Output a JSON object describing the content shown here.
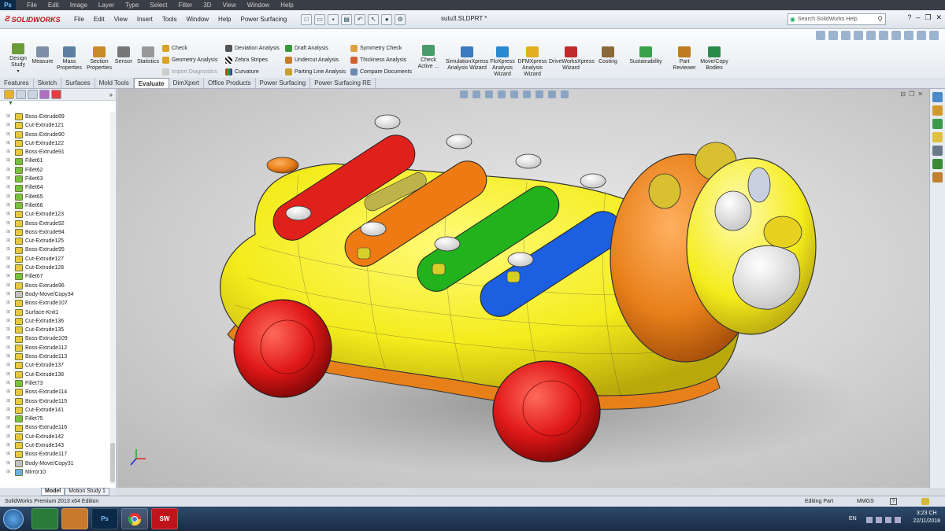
{
  "ps_menu": [
    "File",
    "Edit",
    "Image",
    "Layer",
    "Type",
    "Select",
    "Filter",
    "3D",
    "View",
    "Window",
    "Help"
  ],
  "app": {
    "logo_text": "SOLIDWORKS",
    "doc_title": "sutu3.SLDPRT *",
    "search_placeholder": "Search SolidWorks Help"
  },
  "menu": [
    "File",
    "Edit",
    "View",
    "Insert",
    "Tools",
    "Window",
    "Help",
    "Power Surfacing"
  ],
  "ribbon": {
    "design_study": "Design Study",
    "measure": "Measure",
    "mass_properties": "Mass Properties",
    "section_properties": "Section Properties",
    "sensor": "Sensor",
    "statistics": "Statistics",
    "check": "Check",
    "geometry_analysis": "Geometry Analysis",
    "import_diagnostics": "Import Diagnostics",
    "deviation_analysis": "Deviation Analysis",
    "zebra_stripes": "Zebra Stripes",
    "curvature": "Curvature",
    "draft_analysis": "Draft Analysis",
    "undercut_analysis": "Undercut Analysis",
    "parting_line_analysis": "Parting Line Analysis",
    "symmetry_check": "Symmetry Check",
    "thickness_analysis": "Thickness Analysis",
    "compare_documents": "Compare Documents",
    "check_active": "Check Active ...",
    "simulationxpress": "SimulationXpress Analysis Wizard",
    "floxpress": "FloXpress Analysis Wizard",
    "dfmxpress": "DFMXpress Analysis Wizard",
    "driveworksxpress": "DriveWorksXpress Wizard",
    "costing": "Costing",
    "sustainability": "Sustainability",
    "part_reviewer": "Part Reviewer",
    "move_copy_bodies": "Move/Copy Bodies"
  },
  "tabs": [
    "Features",
    "Sketch",
    "Surfaces",
    "Mold Tools",
    "Evaluate",
    "DimXpert",
    "Office Products",
    "Power Surfacing",
    "Power Surfacing RE"
  ],
  "active_tab": "Evaluate",
  "features": [
    {
      "name": "Boss-Extrude89",
      "type": "extrude"
    },
    {
      "name": "Cut-Extrude121",
      "type": "extrude"
    },
    {
      "name": "Boss-Extrude90",
      "type": "extrude"
    },
    {
      "name": "Cut-Extrude122",
      "type": "extrude"
    },
    {
      "name": "Boss-Extrude91",
      "type": "extrude"
    },
    {
      "name": "Fillet61",
      "type": "fillet"
    },
    {
      "name": "Fillet62",
      "type": "fillet"
    },
    {
      "name": "Fillet63",
      "type": "fillet"
    },
    {
      "name": "Fillet64",
      "type": "fillet"
    },
    {
      "name": "Fillet65",
      "type": "fillet"
    },
    {
      "name": "Fillet66",
      "type": "fillet"
    },
    {
      "name": "Cut-Extrude123",
      "type": "extrude"
    },
    {
      "name": "Boss-Extrude92",
      "type": "extrude"
    },
    {
      "name": "Boss-Extrude94",
      "type": "extrude"
    },
    {
      "name": "Cut-Extrude125",
      "type": "extrude"
    },
    {
      "name": "Boss-Extrude95",
      "type": "extrude"
    },
    {
      "name": "Cut-Extrude127",
      "type": "extrude"
    },
    {
      "name": "Cut-Extrude128",
      "type": "extrude"
    },
    {
      "name": "Fillet67",
      "type": "fillet"
    },
    {
      "name": "Boss-Extrude96",
      "type": "extrude"
    },
    {
      "name": "Body-Move/Copy34",
      "type": "move"
    },
    {
      "name": "Boss-Extrude107",
      "type": "extrude"
    },
    {
      "name": "Surface-Knit1",
      "type": "knit"
    },
    {
      "name": "Cut-Extrude136",
      "type": "extrude"
    },
    {
      "name": "Cut-Extrude135",
      "type": "extrude"
    },
    {
      "name": "Boss-Extrude109",
      "type": "extrude"
    },
    {
      "name": "Boss-Extrude112",
      "type": "extrude"
    },
    {
      "name": "Boss-Extrude113",
      "type": "extrude"
    },
    {
      "name": "Cut-Extrude137",
      "type": "extrude"
    },
    {
      "name": "Cut-Extrude138",
      "type": "extrude"
    },
    {
      "name": "Fillet73",
      "type": "fillet"
    },
    {
      "name": "Boss-Extrude114",
      "type": "extrude"
    },
    {
      "name": "Boss-Extrude115",
      "type": "extrude"
    },
    {
      "name": "Cut-Extrude141",
      "type": "extrude"
    },
    {
      "name": "Fillet75",
      "type": "fillet"
    },
    {
      "name": "Boss-Extrude116",
      "type": "extrude"
    },
    {
      "name": "Cut-Extrude142",
      "type": "extrude"
    },
    {
      "name": "Cut-Extrude143",
      "type": "extrude"
    },
    {
      "name": "Boss-Extrude117",
      "type": "extrude"
    },
    {
      "name": "Body-Move/Copy31",
      "type": "move"
    },
    {
      "name": "Mirror10",
      "type": "mirror"
    }
  ],
  "bottom_tabs": [
    "Model",
    "Motion Study 1"
  ],
  "status": {
    "edition": "SolidWorks Premium 2013 x64 Edition",
    "mode": "Editing Part",
    "units": "MMGS",
    "help": "?"
  },
  "taskbar": {
    "lang": "EN",
    "time": "3:23 CH",
    "date": "22/11/2018",
    "ps_label": "Ps",
    "sw_label": "SW"
  },
  "colors": {
    "body": "#f4ec1c",
    "wheel": "#e01818",
    "mane": "#e8801a",
    "key_red": "#e0201a",
    "key_orange": "#ee7a14",
    "key_green": "#22b21e",
    "key_blue": "#1c5fe0",
    "face": "#f1f1f1",
    "sw_red": "#c0141c"
  }
}
